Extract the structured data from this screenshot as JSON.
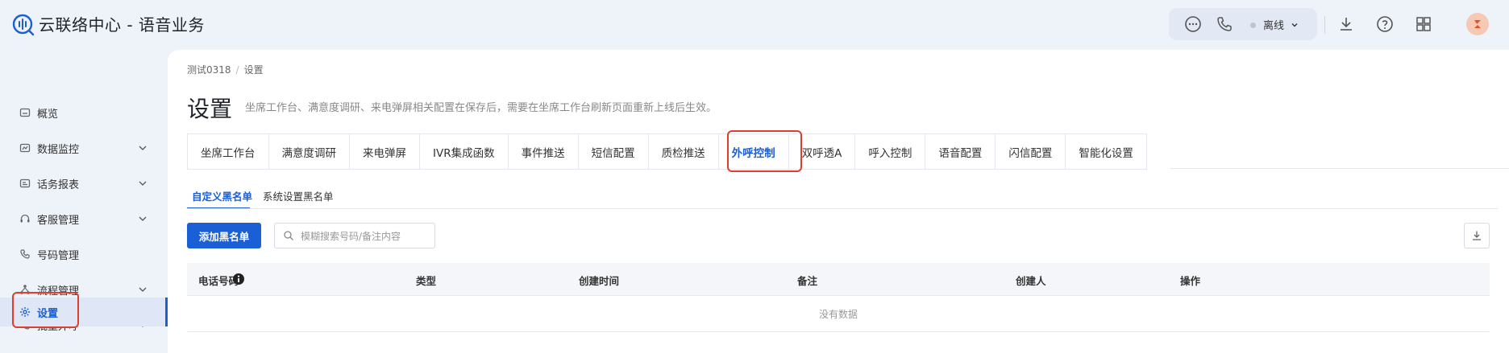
{
  "app": {
    "title": "云联络中心 - 语音业务"
  },
  "header": {
    "status_label": "离线",
    "icons": [
      "chat-icon",
      "phone-icon",
      "download-icon",
      "help-icon",
      "grid-icon",
      "avatar"
    ]
  },
  "sidebar": {
    "items": [
      {
        "label": "概览",
        "icon": "overview-icon",
        "has_chevron": false
      },
      {
        "label": "数据监控",
        "icon": "monitor-icon",
        "has_chevron": true
      },
      {
        "label": "话务报表",
        "icon": "report-icon",
        "has_chevron": true
      },
      {
        "label": "客服管理",
        "icon": "headset-icon",
        "has_chevron": true
      },
      {
        "label": "号码管理",
        "icon": "phone-icon",
        "has_chevron": false
      },
      {
        "label": "流程管理",
        "icon": "flow-icon",
        "has_chevron": true
      },
      {
        "label": "批量外呼",
        "icon": "batch-call-icon",
        "has_chevron": true
      },
      {
        "label": "设置",
        "icon": "gear-icon",
        "has_chevron": false,
        "active": true
      }
    ]
  },
  "breadcrumb": {
    "items": [
      "测试0318",
      "设置"
    ]
  },
  "page": {
    "title": "设置",
    "description": "坐席工作台、满意度调研、来电弹屏相关配置在保存后，需要在坐席工作台刷新页面重新上线后生效。"
  },
  "tabs": [
    {
      "label": "坐席工作台"
    },
    {
      "label": "满意度调研"
    },
    {
      "label": "来电弹屏"
    },
    {
      "label": "IVR集成函数"
    },
    {
      "label": "事件推送"
    },
    {
      "label": "短信配置"
    },
    {
      "label": "质检推送"
    },
    {
      "label": "外呼控制",
      "active": true
    },
    {
      "label": "双呼透A"
    },
    {
      "label": "呼入控制"
    },
    {
      "label": "语音配置"
    },
    {
      "label": "闪信配置"
    },
    {
      "label": "智能化设置"
    }
  ],
  "subtabs": [
    {
      "label": "自定义黑名单",
      "active": true
    },
    {
      "label": "系统设置黑名单"
    }
  ],
  "toolbar": {
    "add_button": "添加黑名单",
    "search_placeholder": "模糊搜索号码/备注内容"
  },
  "table": {
    "columns": [
      "电话号码",
      "类型",
      "创建时间",
      "备注",
      "创建人",
      "操作"
    ],
    "empty_text": "没有数据"
  },
  "colors": {
    "accent": "#1a5fd6",
    "highlight": "#e03e2d",
    "background": "#eef2f9"
  }
}
